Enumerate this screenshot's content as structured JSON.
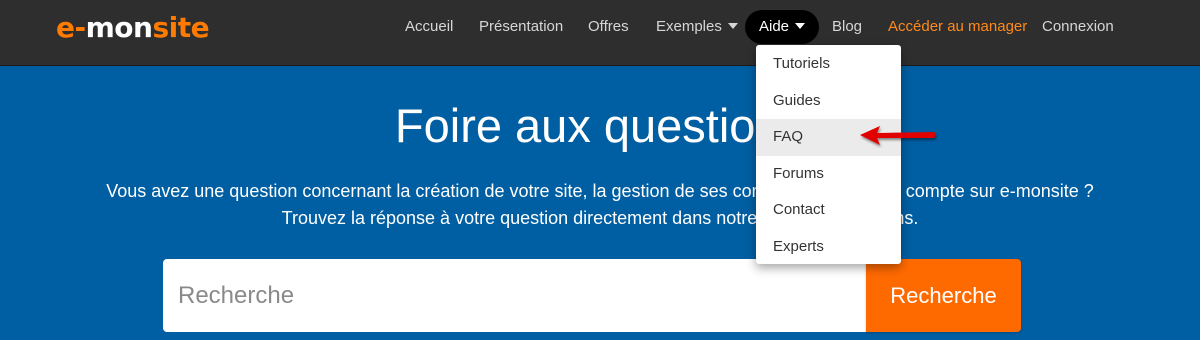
{
  "logo": {
    "part1": "e-",
    "part2": "mon",
    "part3": "site"
  },
  "nav": {
    "items": [
      {
        "label": "Accueil"
      },
      {
        "label": "Présentation"
      },
      {
        "label": "Offres"
      },
      {
        "label": "Exemples"
      },
      {
        "label": "Aide"
      },
      {
        "label": "Blog"
      },
      {
        "label": "Accéder au manager"
      },
      {
        "label": "Connexion"
      }
    ]
  },
  "dropdown": {
    "items": [
      {
        "label": "Tutoriels"
      },
      {
        "label": "Guides"
      },
      {
        "label": "FAQ"
      },
      {
        "label": "Forums"
      },
      {
        "label": "Contact"
      },
      {
        "label": "Experts"
      }
    ]
  },
  "hero": {
    "title": "Foire aux questions",
    "line1": "Vous avez une question concernant la création de votre site, la gestion de ses contenus ou de votre compte sur e-monsite ?",
    "line2": "Trouvez la réponse à votre question directement dans notre foire aux questions."
  },
  "search": {
    "placeholder": "Recherche",
    "button_label": "Recherche"
  },
  "colors": {
    "brand_orange": "#ff7a00",
    "hero_blue": "#005ea2",
    "nav_bg": "#2e2e2e",
    "search_button": "#ff6a00",
    "annotation_arrow": "#e00000"
  }
}
